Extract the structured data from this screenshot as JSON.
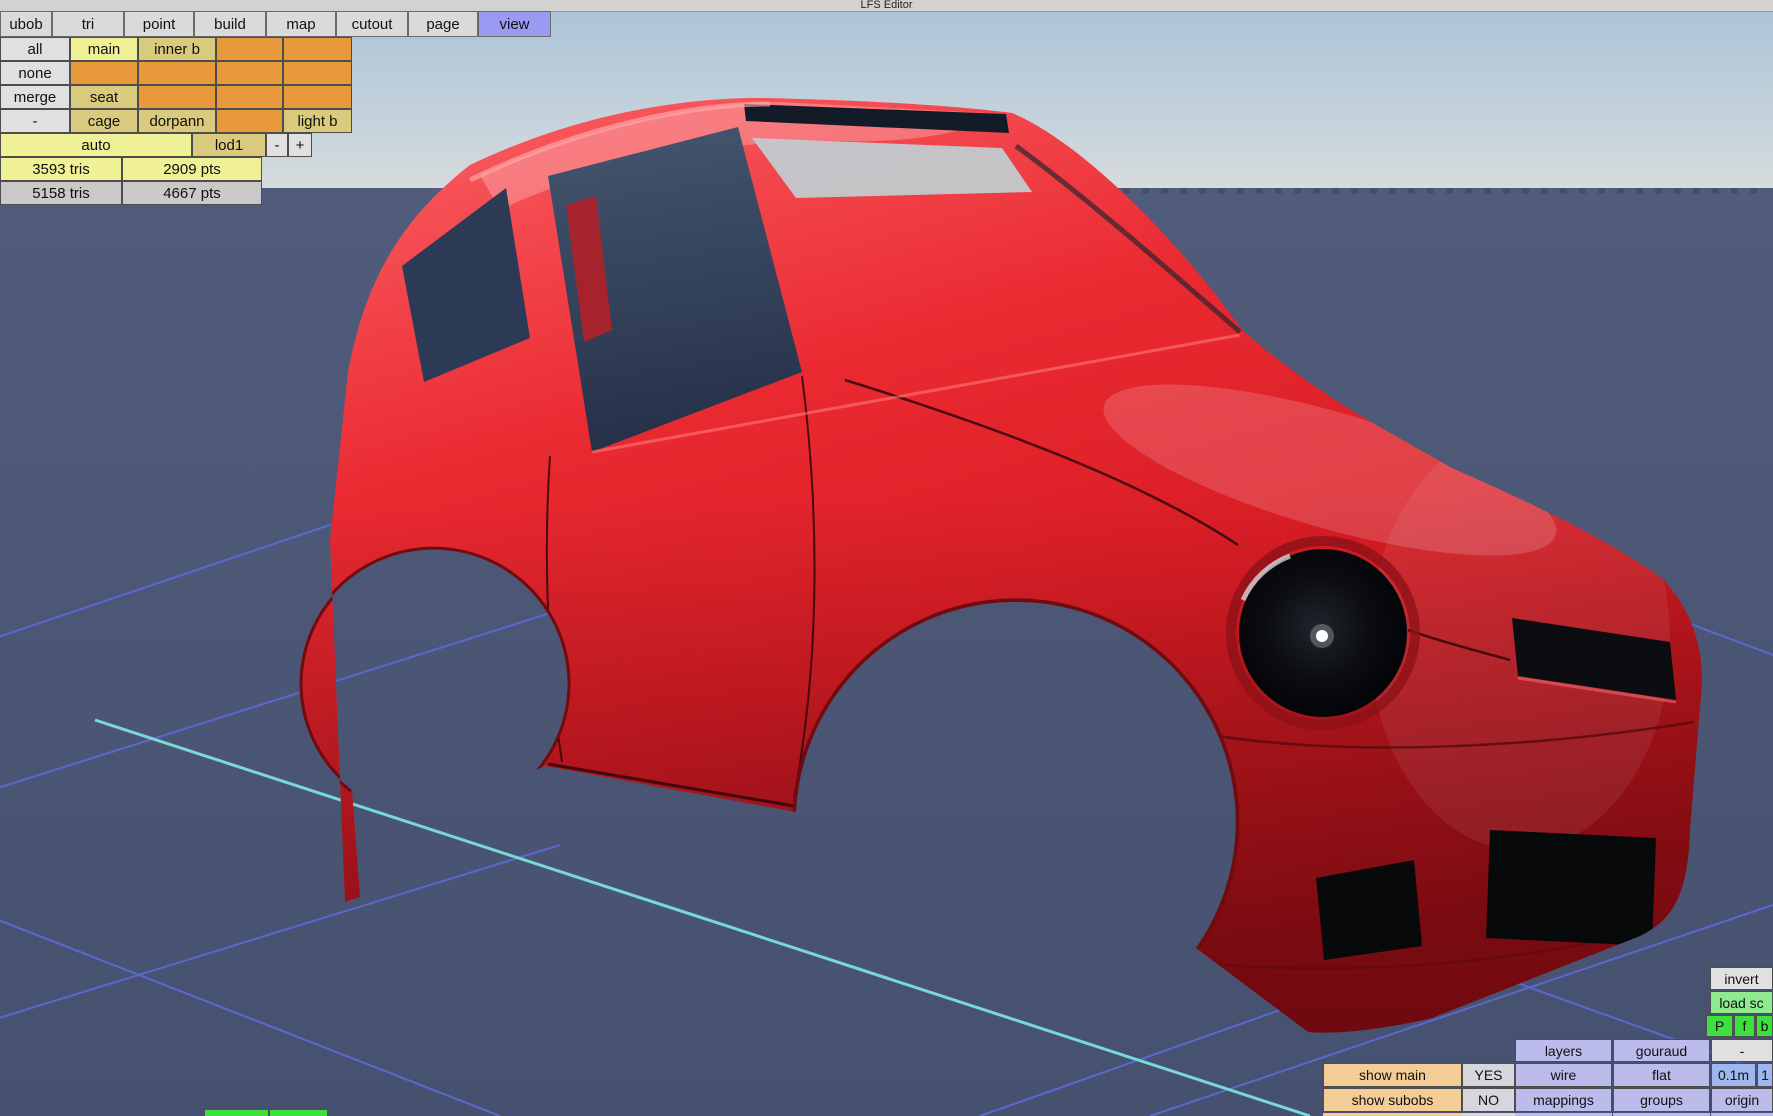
{
  "window": {
    "title": "LFS Editor"
  },
  "menu": {
    "items": [
      "ubob",
      "tri",
      "point",
      "build",
      "map",
      "cutout",
      "page",
      "view"
    ],
    "active_item": "view"
  },
  "selection_grid": {
    "rows": [
      [
        {
          "label": "all"
        },
        {
          "label": "main"
        },
        {
          "label": "inner b"
        },
        {
          "label": ""
        },
        {
          "label": ""
        }
      ],
      [
        {
          "label": "none"
        },
        {
          "label": ""
        },
        {
          "label": ""
        },
        {
          "label": ""
        },
        {
          "label": ""
        }
      ],
      [
        {
          "label": "merge"
        },
        {
          "label": "seat"
        },
        {
          "label": ""
        },
        {
          "label": ""
        },
        {
          "label": ""
        }
      ],
      [
        {
          "label": "-"
        },
        {
          "label": "cage"
        },
        {
          "label": "dorpann"
        },
        {
          "label": ""
        },
        {
          "label": "light b"
        }
      ]
    ]
  },
  "lod_bar": {
    "auto_label": "auto",
    "lod_label": "lod1",
    "minus": "-",
    "plus": "+"
  },
  "stats": {
    "lod_current": {
      "tris": "3593 tris",
      "points": "2909 pts"
    },
    "lod_total": {
      "tris": "5158 tris",
      "points": "4667 pts"
    }
  },
  "right_panel": {
    "invert_label": "invert",
    "load_script_label": "load sc",
    "pfb": [
      "P",
      "f",
      "b"
    ],
    "layers_label": "layers",
    "gouraud_label": "gouraud",
    "minus_label": "-",
    "show_main_label": "show main",
    "show_main_value": "YES",
    "wire_label": "wire",
    "flat_label": "flat",
    "grid_size": "0.1m",
    "grid_suffix": "1",
    "show_subobs_label": "show subobs",
    "show_subobs_value": "NO",
    "mappings_label": "mappings",
    "groups_label": "groups",
    "origin_label": "origin"
  },
  "viewport": {
    "colors": {
      "car_body": "#d81c24",
      "sky_top": "#a9c3d8",
      "sky_horizon": "#d6dbdd",
      "ground": "#4c5875",
      "grid_line": "#5b6bd8",
      "grid_axis": "#7de8e0"
    }
  }
}
